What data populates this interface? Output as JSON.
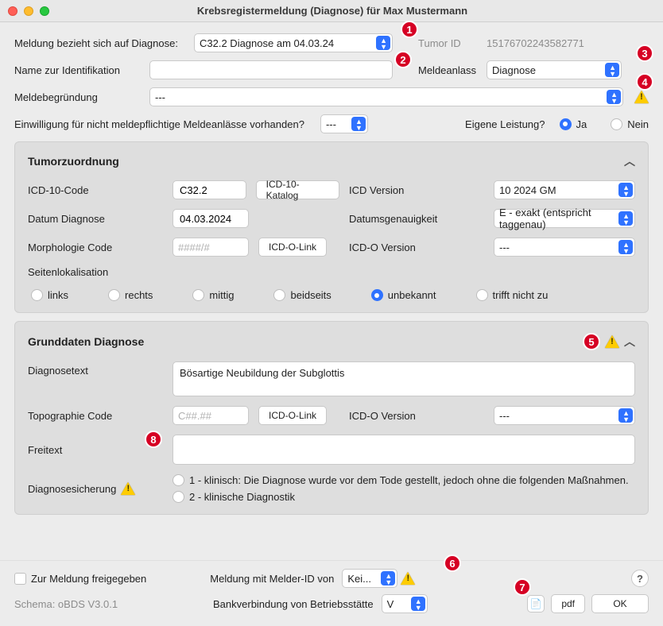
{
  "window": {
    "title": "Krebsregistermeldung (Diagnose) für Max Mustermann"
  },
  "top": {
    "diag_label": "Meldung bezieht sich auf Diagnose:",
    "diag_select": "C32.2    Diagnose am 04.03.24",
    "tumor_id_label": "Tumor ID",
    "tumor_id_value": "15176702243582771",
    "name_label": "Name zur Identifikation",
    "name_value": "",
    "anlass_label": "Meldeanlass",
    "anlass_value": "Diagnose",
    "begr_label": "Meldebegründung",
    "begr_value": "---",
    "einw_label": "Einwilligung für nicht meldepflichtige Meldeanlässe vorhanden?",
    "einw_value": "---",
    "eigene_label": "Eigene Leistung?",
    "ja": "Ja",
    "nein": "Nein"
  },
  "tumor": {
    "title": "Tumorzuordnung",
    "icd10_label": "ICD-10-Code",
    "icd10_value": "C32.2",
    "icd10_katalog": "ICD-10-Katalog",
    "icdver_label": "ICD Version",
    "icdver_value": "10 2024 GM",
    "datum_label": "Datum Diagnose",
    "datum_value": "04.03.2024",
    "genau_label": "Datumsgenauigkeit",
    "genau_value": "E - exakt (entspricht taggenau)",
    "morph_label": "Morphologie Code",
    "morph_ph": "####/#",
    "icdo_link": "ICD-O-Link",
    "icdo_ver_label": "ICD-O Version",
    "icdo_ver_value": "---",
    "seiten_label": "Seitenlokalisation",
    "r_links": "links",
    "r_rechts": "rechts",
    "r_mittig": "mittig",
    "r_beid": "beidseits",
    "r_unb": "unbekannt",
    "r_tnz": "trifft nicht zu"
  },
  "grund": {
    "title": "Grunddaten Diagnose",
    "diagtext_label": "Diagnosetext",
    "diagtext_value": "Bösartige Neubildung der Subglottis",
    "topo_label": "Topographie Code",
    "topo_ph": "C##.##",
    "icdo_link": "ICD-O-Link",
    "icdo_ver_label": "ICD-O Version",
    "icdo_ver_value": "---",
    "freitext_label": "Freitext",
    "sicher_label": "Diagnosesicherung",
    "sicher_1": "1 - klinisch: Die Diagnose wurde vor dem Tode gestellt, jedoch ohne die folgenden Maßnahmen.",
    "sicher_2": "2 - klinische Diagnostik"
  },
  "bottom": {
    "freigabe": "Zur Meldung freigegeben",
    "melder_label": "Meldung mit Melder-ID von",
    "melder_value": "Kei...",
    "bank_label": "Bankverbindung von Betriebsstätte",
    "bank_value": "V",
    "schema": "Schema: oBDS V3.0.1",
    "pdf": "pdf",
    "ok": "OK"
  },
  "annotations": [
    "1",
    "2",
    "3",
    "4",
    "5",
    "6",
    "7",
    "8"
  ]
}
